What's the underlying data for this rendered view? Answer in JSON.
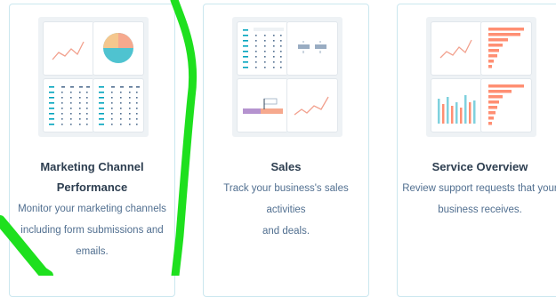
{
  "cards": [
    {
      "title_lines": [
        "Marketing Channel",
        "Performance"
      ],
      "description_lines": [
        "Monitor your marketing channels",
        "including form submissions and",
        "emails."
      ],
      "thumbnail": "marketing-dashboard-thumbnail"
    },
    {
      "title_lines": [
        "Sales"
      ],
      "description_lines": [
        "Track your business's sales activities",
        "and deals."
      ],
      "thumbnail": "sales-dashboard-thumbnail"
    },
    {
      "title_lines": [
        "Service Overview"
      ],
      "description_lines": [
        "Review support requests that your",
        "business receives."
      ],
      "thumbnail": "service-dashboard-thumbnail"
    }
  ],
  "colors": {
    "card_border": "#cbe7ef",
    "thumb_bg": "#eef2f5",
    "line_chart": "#f2a08d",
    "pie_orange": "#f5c78e",
    "pie_teal": "#4fc3d0",
    "bar_salmon": "#ff8f73",
    "bar_teal": "#7fd1de",
    "table_teal": "#00a4bd",
    "scribble": "#1ee01e"
  },
  "overlay": "green-freehand-scribble"
}
